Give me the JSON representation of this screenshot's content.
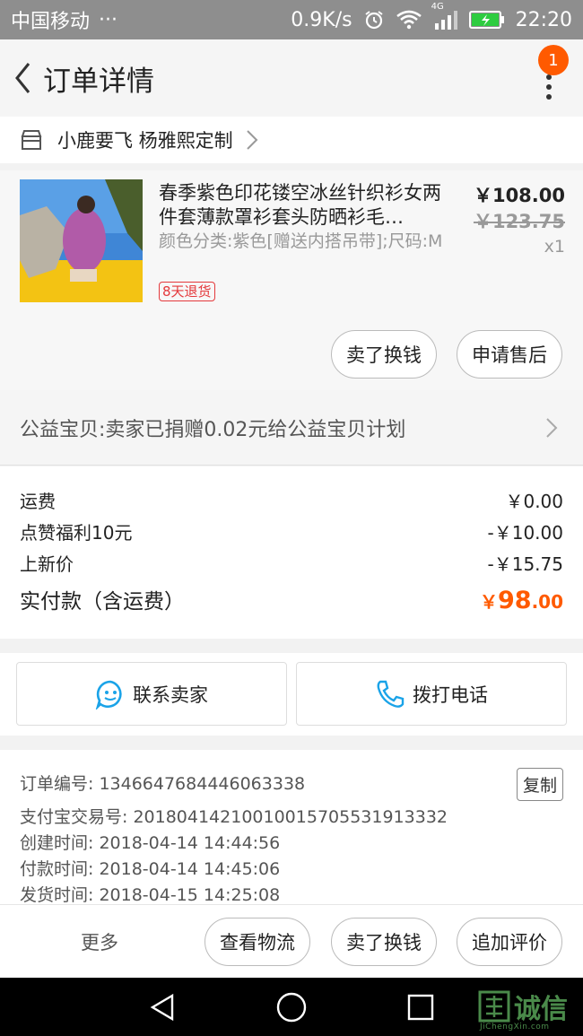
{
  "status_bar": {
    "carrier": "中国移动",
    "dots": "···",
    "speed": "0.9K/s",
    "network": "4G",
    "time": "22:20"
  },
  "nav": {
    "title": "订单详情",
    "badge_count": "1"
  },
  "shop": {
    "name": "小鹿要飞 杨雅熙定制"
  },
  "item": {
    "title": "春季紫色印花镂空冰丝针织衫女两件套薄款罩衫套头防晒衫毛…",
    "spec": "颜色分类:紫色[赠送内搭吊带];尺码:M",
    "return_tag": "8天退货",
    "price_now": "￥108.00",
    "price_old": "￥123.75",
    "quantity": "x1",
    "buttons": [
      "卖了换钱",
      "申请售后"
    ]
  },
  "charity": {
    "text": "公益宝贝:卖家已捐赠0.02元给公益宝贝计划"
  },
  "costs": {
    "rows": [
      {
        "label": "运费",
        "value": "￥0.00"
      },
      {
        "label": "点赞福利10元",
        "value": "-￥10.00"
      },
      {
        "label": "上新价",
        "value": "-￥15.75"
      }
    ],
    "total_label": "实付款（含运费）",
    "total_symbol": "￥",
    "total_int": "98",
    "total_dec": ".00"
  },
  "contact": {
    "seller": "联系卖家",
    "call": "拨打电话"
  },
  "order_info": {
    "order_no": "订单编号: 1346647684446063338",
    "copy": "复制",
    "alipay_no": "支付宝交易号: 20180414210010015705531913332",
    "created": "创建时间: 2018-04-14 14:44:56",
    "paid": "付款时间: 2018-04-14 14:45:06",
    "shipped": "发货时间: 2018-04-15 14:25:08"
  },
  "action_bar": {
    "more": "更多",
    "buttons": [
      "查看物流",
      "卖了换钱",
      "追加评价"
    ]
  },
  "watermark": {
    "brand": "诚信",
    "site": "JiChengXin.com"
  },
  "colors": {
    "accent": "#ff5a00",
    "tag_red": "#e4393c",
    "icon_blue": "#1aa3e8"
  }
}
